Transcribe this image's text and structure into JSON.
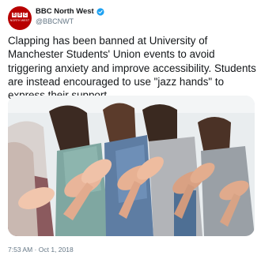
{
  "account": {
    "display_name": "BBC North West",
    "handle": "@BBCNWT",
    "verified": true,
    "avatar_letters": [
      "B",
      "B",
      "C"
    ],
    "avatar_subtitle": "NORTH WEST",
    "avatar_color": "#b80000"
  },
  "tweet": {
    "text": "Clapping has been banned at University of Manchester Students' Union events to avoid triggering anxiety and improve accessibility. Students are instead encouraged to use \"jazz hands\" to express their support.",
    "timestamp": "7:53 AM · Oct 1, 2018",
    "photo_icon": "clapping-people-photo"
  },
  "colors": {
    "text": "#14171a",
    "secondary": "#657786",
    "verified": "#1da1f2"
  }
}
